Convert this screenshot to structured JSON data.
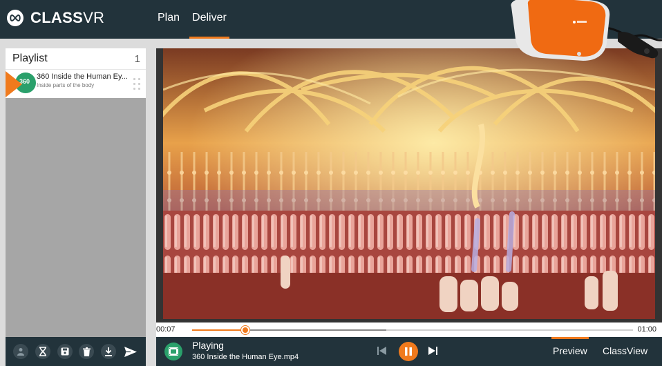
{
  "header": {
    "logo_bold": "CLASS",
    "logo_thin": "VR",
    "nav": [
      {
        "label": "Plan",
        "active": false
      },
      {
        "label": "Deliver",
        "active": true
      }
    ]
  },
  "playlist": {
    "title": "Playlist",
    "count": "1",
    "items": [
      {
        "title": "360 Inside the Human Ey...",
        "subtitle": "Inside parts of the body",
        "thumb_text": "360"
      }
    ]
  },
  "sidebar_tools": [
    "user-icon",
    "hourglass-icon",
    "save-icon",
    "trash-icon",
    "download-icon",
    "send-icon"
  ],
  "player": {
    "current_time": "00:07",
    "total_time": "01:00",
    "progress": 0.121,
    "buffered": 0.44,
    "status": "Playing",
    "file_name": "360 Inside the Human Eye.mp4",
    "views": [
      {
        "label": "Preview",
        "active": true
      },
      {
        "label": "ClassView",
        "active": false
      }
    ]
  },
  "colors": {
    "accent": "#f07a1d",
    "header_bg": "#22333b",
    "thumb_green": "#2aa06b"
  }
}
